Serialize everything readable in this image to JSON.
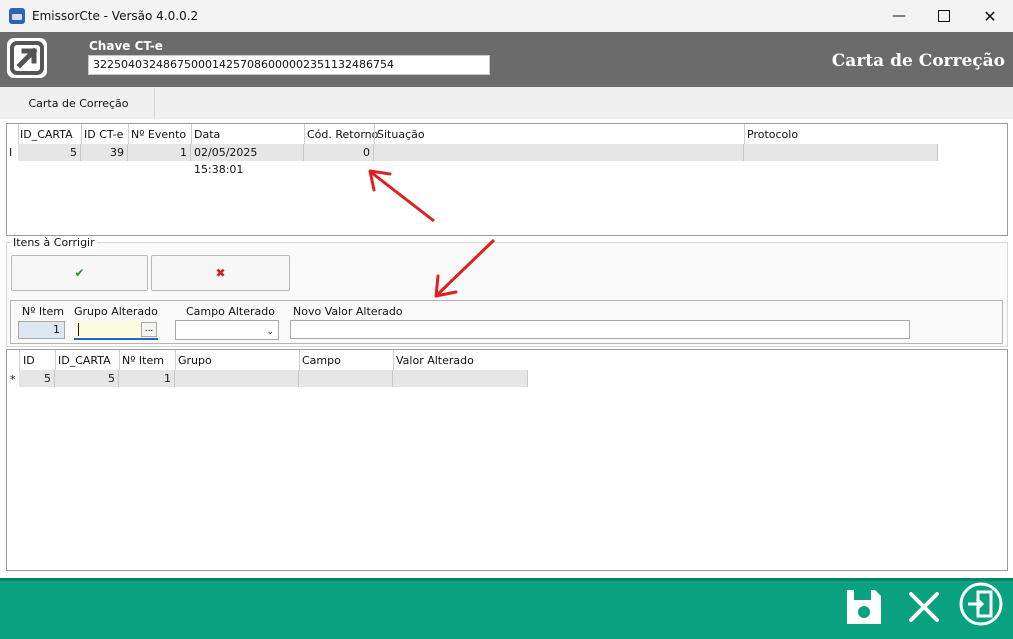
{
  "window": {
    "title": "EmissorCte - Versão 4.0.0.2"
  },
  "header": {
    "chave_label": "Chave CT-e",
    "chave_value": "32250403248675000142570860000023511324867​54",
    "page_title": "Carta de Correção"
  },
  "tabs": [
    {
      "label": "Carta de Correção",
      "active": true
    }
  ],
  "eventos_grid": {
    "columns": [
      "ID_CARTA",
      "ID CT-e",
      "Nº Evento",
      "Data",
      "Cód. Retorno",
      "Situação",
      "Protocolo"
    ],
    "row_indicator": "I",
    "rows": [
      {
        "id_carta": "5",
        "id_cte": "39",
        "n_evento": "1",
        "data": "02/05/2025 15:38:01",
        "cod_retorno": "0",
        "situacao": "",
        "protocolo": ""
      }
    ]
  },
  "itens": {
    "group_label": "Itens à Corrigir",
    "confirm_icon": "check-icon",
    "cancel_icon": "x-icon",
    "labels": {
      "n_item": "Nº Item",
      "grupo": "Grupo Alterado",
      "campo": "Campo Alterado",
      "novo_valor": "Novo Valor Alterado"
    },
    "values": {
      "n_item": "1",
      "grupo": "",
      "grupo_button": "...",
      "campo": "",
      "novo_valor": ""
    }
  },
  "itens_grid": {
    "columns": [
      "ID",
      "ID_CARTA",
      "Nº Item",
      "Grupo",
      "Campo",
      "Valor Alterado"
    ],
    "row_indicator": "*",
    "rows": [
      {
        "id": "5",
        "id_carta": "5",
        "n_item": "1",
        "grupo": "",
        "campo": "",
        "valor": ""
      }
    ]
  },
  "footer": {
    "save_icon": "save-icon",
    "cancel_icon": "close-icon",
    "exit_icon": "exit-door-icon"
  },
  "colors": {
    "header_bg": "#6b6b6b",
    "footer_bg": "#0aa181",
    "annotation_arrow": "#e02020"
  }
}
